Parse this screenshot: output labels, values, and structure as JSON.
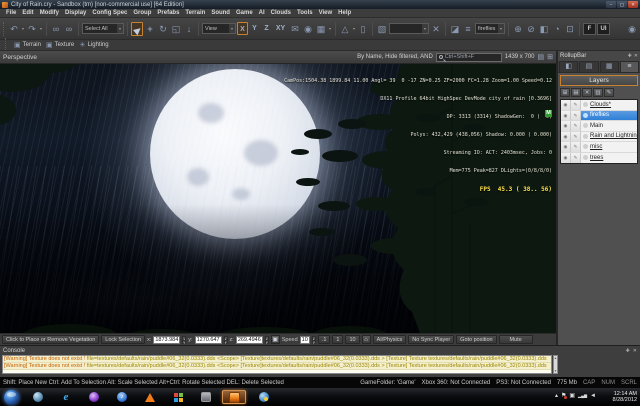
{
  "window": {
    "title": "City of Rain.cry - Sandbox (tm) [non-commercial use] [64 Edition]",
    "minimize": "–",
    "maximize": "▢",
    "close": "✕"
  },
  "menu": {
    "items": [
      "File",
      "Edit",
      "Modify",
      "Display",
      "Config Spec",
      "Group",
      "Prefabs",
      "Terrain",
      "Sound",
      "Game",
      "AI",
      "Clouds",
      "Tools",
      "View",
      "Help"
    ]
  },
  "toolbar": {
    "select_all_combo": "Select All",
    "view_combo": "View",
    "axis_x": "X",
    "axis_y": "Y",
    "axis_z": "Z",
    "axis_xy": "XY",
    "layer_combo": "fireflies",
    "f_button": "F",
    "ui_button": "UI"
  },
  "snap_toolbar": {
    "terrain": "Terrain",
    "texture": "Texture",
    "lighting": "Lighting"
  },
  "viewport": {
    "label": "Perspective",
    "filter_label": "By Name, Hide filtered, AND",
    "search_shortcut": "Ctrl+Shift+F",
    "resolution": "1439 x 700",
    "debug_lines": [
      "CamPos:1504.38 1899.84 11.00 Angl= 39  0 -17 ZN=0.25 ZF=2000 FC=1.28 Zoom=1.00 Speed=0.12",
      "DX11 Profile 64bit HighSpec DevMode city of rain [0.3696]",
      "DP: 3313 (3314) ShadowGen:  0 (  0)",
      "Polys: 432,429 (438,056) Shadow: 0.000 ( 0.000)",
      "Streaming IO: ACT: 2403msec, Jobs: 0",
      "Mem=775 Peak=827 DLights=(0/8/8/0)"
    ],
    "fps_line": "FPS  45.3 ( 38.. 56)",
    "memory_badge": "M"
  },
  "vegetation_bar": {
    "place_button": "Click to Place or Remove Vegetation",
    "lock_selection": "Lock Selection",
    "x_label": "x:",
    "x_value": "1873.984",
    "y_label": "y:",
    "y_value": "1270.647",
    "z_label": "z:",
    "z_value": "269.4946",
    "speed_label": "Speed",
    "speed_value": "10",
    "preset_point1": ".1",
    "preset_1": "1",
    "preset_10": "10",
    "ai_physics": "AI/Physics",
    "no_sync": "No Sync Player",
    "goto_position": "Goto position",
    "mute": "Mute"
  },
  "rollupbar": {
    "title": "RollupBar",
    "layers_header": "Layers",
    "layers": [
      {
        "name": "Clouds*"
      },
      {
        "name": "fireflies"
      },
      {
        "name": "Main"
      },
      {
        "name": "Rain and Lightning"
      },
      {
        "name": "misc"
      },
      {
        "name": "trees"
      }
    ]
  },
  "console": {
    "title": "Console",
    "warning_prefix": "[Warning] Texture does not exist ! ",
    "line_body": "file=textures/defaults/rain/puddle#06_32(0.0333).dds    <Scope> [Texture]textures/defaults/rain/puddle#06_32(0.0333).dds > [Texture] Texture textures/defaults/rain/puddle#06_32(0.0333).dds"
  },
  "status_bar": {
    "hints": "Shift: Place New  Ctrl: Add To Selection  Alt: Scale Selected  Alt+Ctrl: Rotate Selected DEL: Delete Selected",
    "game_folder": "GameFolder: 'Game'",
    "xbox": "Xbox 360: Not Connected",
    "ps3": "PS3: Not Connected",
    "memory": "775 Mb",
    "cap": "CAP",
    "num": "NUM",
    "scrl": "SCRL"
  },
  "taskbar": {
    "time": "12:14 AM",
    "date": "8/28/2012"
  },
  "colors": {
    "selection_orange": "#c8822f",
    "layer_selected_blue": "#2f7fd6",
    "fps_yellow": "#ffe14a",
    "warning_text": "#9a8500",
    "memory_badge_green": "#2f9e2f"
  },
  "icons": {
    "undo": "↶",
    "redo": "↷",
    "dropdown": "▾",
    "link": "∞",
    "unlink": "∞",
    "select_arrow": "▶",
    "move": "+",
    "rotate": "↻",
    "scale": "◱",
    "pick": "↓",
    "mail": "✉",
    "eye": "◉",
    "grid": "▦",
    "angle": "△",
    "ruler": "▯",
    "clear": "✕",
    "mtl_a": "▧",
    "mtl_b": "◪",
    "layer_stack": "≡",
    "phys_a": "⊕",
    "phys_b": "⊘",
    "phys_c": "◧",
    "phys_d": "◔",
    "phys_e": "⊡",
    "sphere": "◉",
    "bucket": "▣",
    "sun": "☀",
    "pin": "✚",
    "close": "✕",
    "page": "▤",
    "grid2": "⊞",
    "tab_objects": "◧",
    "tab_terrain": "▤",
    "tab_display": "▦",
    "tab_layers": "≡",
    "lt_new": "⊞",
    "lt_folder": "▤",
    "lt_delete": "✕",
    "lt_save": "▥",
    "lt_settings": "✎",
    "eye_small": "◉",
    "edit_small": "✎",
    "lock": "▣",
    "follow": "⌂",
    "caret": "▴",
    "flag": "⚑",
    "tray_window": "▣",
    "net_bars": "▂▄▆",
    "speaker": "◄",
    "scroll_up": "▲",
    "scroll_down": "▼"
  }
}
